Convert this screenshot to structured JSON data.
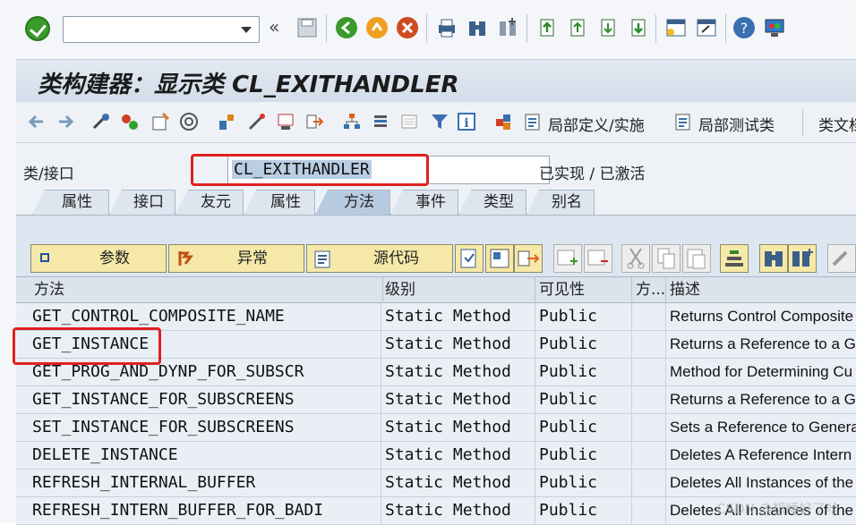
{
  "system_toolbar": {
    "command_field_value": "",
    "icons": [
      "enter-icon",
      "back-nav-icon",
      "save-icon",
      "back-icon",
      "exit-icon",
      "cancel-icon",
      "print-icon",
      "find-icon",
      "find-next-icon",
      "first-page-icon",
      "previous-page-icon",
      "next-page-icon",
      "last-page-icon",
      "create-session-icon",
      "shortcut-icon",
      "help-icon",
      "customize-icon"
    ]
  },
  "title": "类构建器：显示类 CL_EXITHANDLER",
  "app_toolbar": {
    "local_def_label": "局部定义/实施",
    "local_test_label": "局部测试类",
    "class_doc_label": "类文档"
  },
  "header": {
    "field_label": "类/接口",
    "class_name": "CL_EXITHANDLER",
    "status": "已实现 / 已激活"
  },
  "tabs": [
    {
      "label": "属性",
      "active": false
    },
    {
      "label": "接口",
      "active": false
    },
    {
      "label": "友元",
      "active": false
    },
    {
      "label": "属性",
      "active": false
    },
    {
      "label": "方法",
      "active": true
    },
    {
      "label": "事件",
      "active": false
    },
    {
      "label": "类型",
      "active": false
    },
    {
      "label": "别名",
      "active": false
    }
  ],
  "table_toolbar": {
    "params_label": "参数",
    "exceptions_label": "异常",
    "source_label": "源代码"
  },
  "table": {
    "columns": [
      "方法",
      "级别",
      "可见性",
      "方...",
      "描述"
    ],
    "rows": [
      {
        "method": "GET_CONTROL_COMPOSITE_NAME",
        "level": "Static Method",
        "visibility": "Public",
        "desc": "Returns Control Composite"
      },
      {
        "method": "GET_INSTANCE",
        "level": "Static Method",
        "visibility": "Public",
        "desc": "Returns a Reference to a G"
      },
      {
        "method": "GET_PROG_AND_DYNP_FOR_SUBSCR",
        "level": "Static Method",
        "visibility": "Public",
        "desc": "Method for Determining Cu"
      },
      {
        "method": "GET_INSTANCE_FOR_SUBSCREENS",
        "level": "Static Method",
        "visibility": "Public",
        "desc": "Returns a Reference to a G"
      },
      {
        "method": "SET_INSTANCE_FOR_SUBSCREENS",
        "level": "Static Method",
        "visibility": "Public",
        "desc": "Sets a Reference to Genera"
      },
      {
        "method": "DELETE_INSTANCE",
        "level": "Static Method",
        "visibility": "Public",
        "desc": "Deletes A Reference Intern"
      },
      {
        "method": "REFRESH_INTERNAL_BUFFER",
        "level": "Static Method",
        "visibility": "Public",
        "desc": "Deletes All Instances of the"
      },
      {
        "method": "REFRESH_INTERN_BUFFER_FOR_BADI",
        "level": "Static Method",
        "visibility": "Public",
        "desc": "Deletes All Instances of the"
      }
    ]
  },
  "colors": {
    "highlight_box": "#e02020",
    "grid_row": "#e9eff5",
    "title_bg": "#d2dde9"
  },
  "watermark": "CSDN @想睡好了哈"
}
